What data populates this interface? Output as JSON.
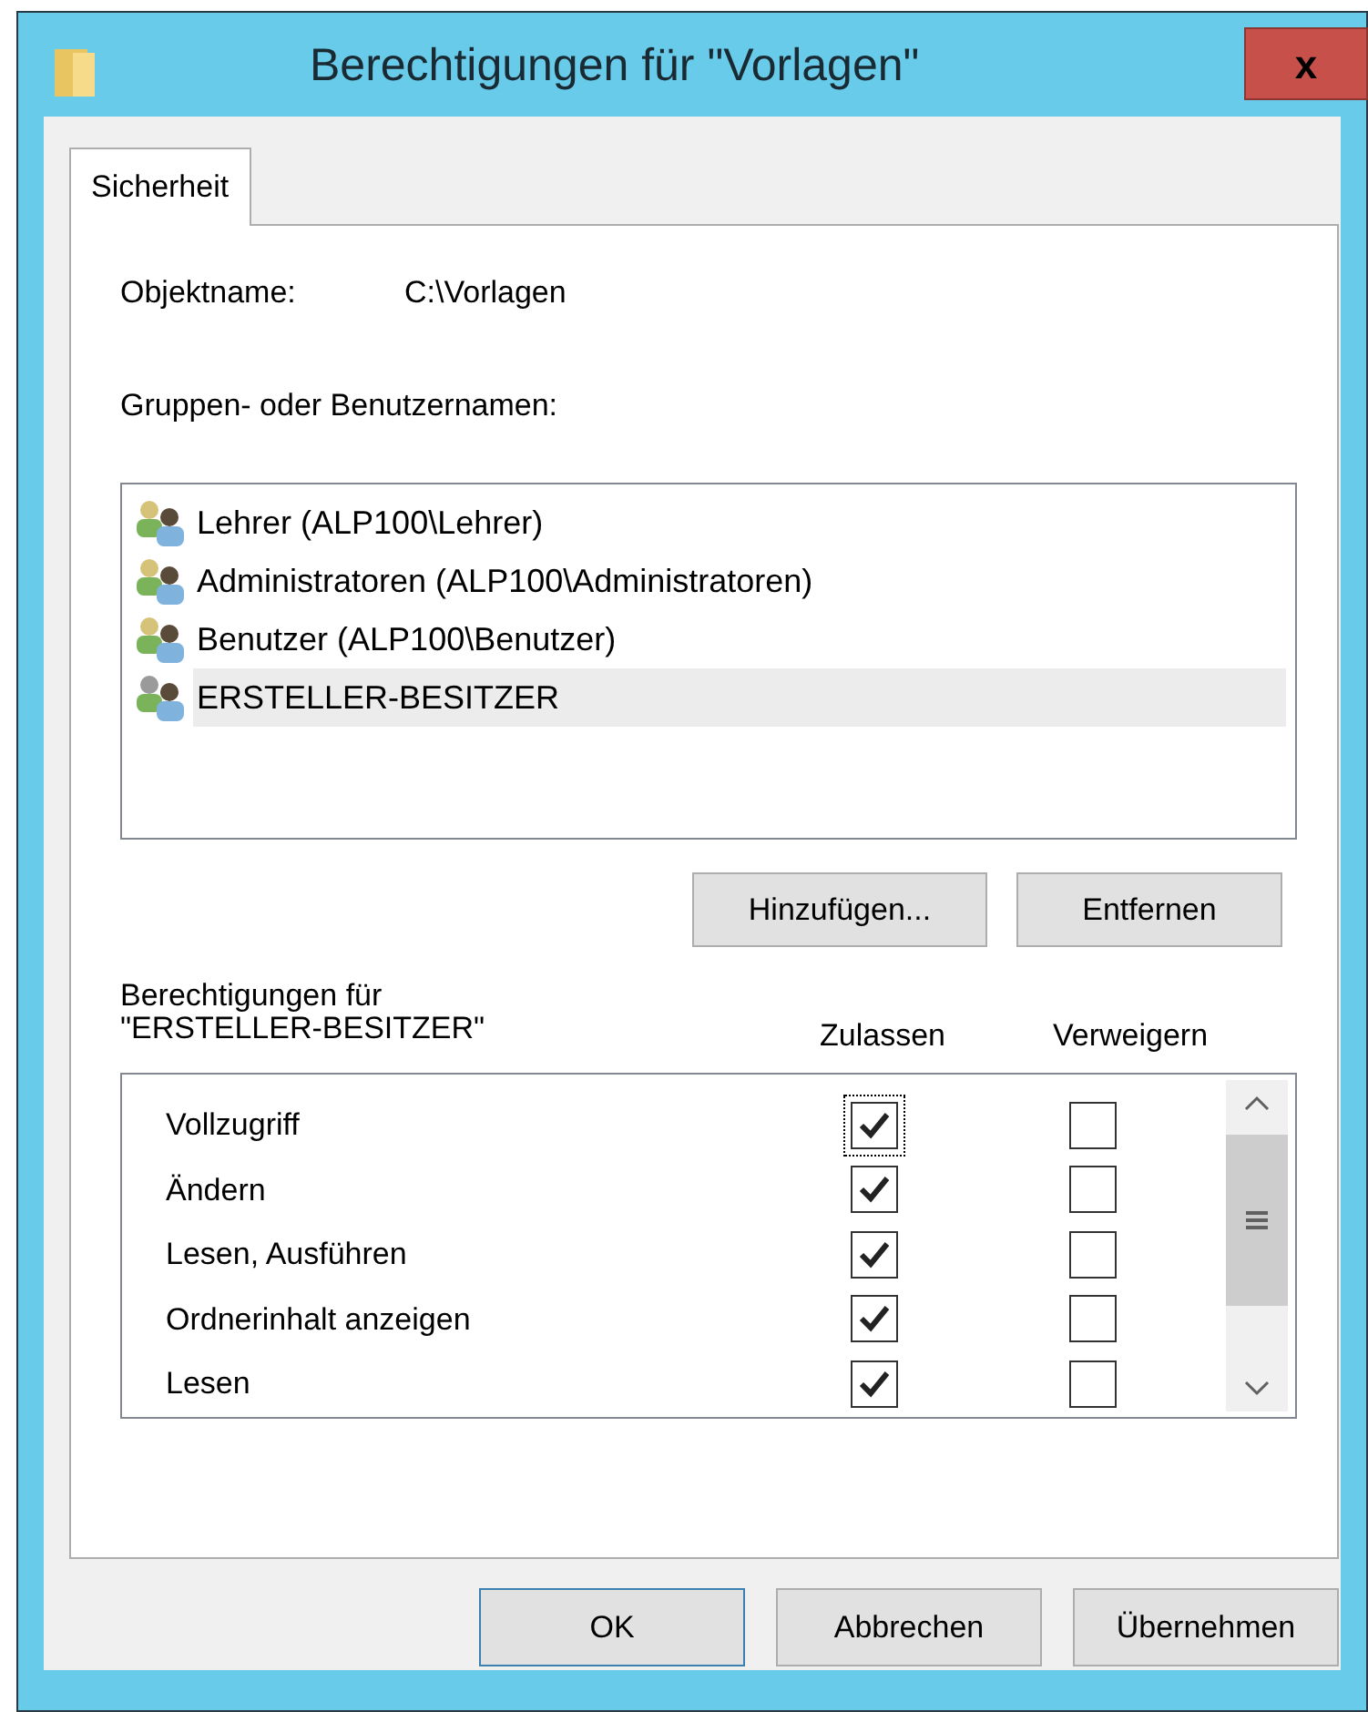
{
  "window": {
    "title": "Berechtigungen für \"Vorlagen\"",
    "close": "x"
  },
  "tabs": [
    {
      "label": "Sicherheit",
      "selected": true
    }
  ],
  "object": {
    "label": "Objektname:",
    "value": "C:\\Vorlagen"
  },
  "groups": {
    "label": "Gruppen- oder Benutzernamen:",
    "items": [
      {
        "name": "Lehrer (ALP100\\Lehrer)",
        "selected": false
      },
      {
        "name": "Administratoren (ALP100\\Administratoren)",
        "selected": false
      },
      {
        "name": "Benutzer (ALP100\\Benutzer)",
        "selected": false
      },
      {
        "name": "ERSTELLER-BESITZER",
        "selected": true
      }
    ]
  },
  "group_buttons": [
    "Hinzufügen...",
    "Entfernen"
  ],
  "permissions": {
    "label_line_1": "Berechtigungen für",
    "label_line_2": "\"ERSTELLER-BESITZER\"",
    "allow_header": "Zulassen",
    "deny_header": "Verweigern",
    "rows": [
      {
        "name": "Vollzugriff",
        "allow": true,
        "deny": false,
        "focused": true
      },
      {
        "name": "Ändern",
        "allow": true,
        "deny": false,
        "focused": false
      },
      {
        "name": "Lesen, Ausführen",
        "allow": true,
        "deny": false,
        "focused": false
      },
      {
        "name": "Ordnerinhalt anzeigen",
        "allow": true,
        "deny": false,
        "focused": false
      },
      {
        "name": "Lesen",
        "allow": true,
        "deny": false,
        "focused": false
      }
    ]
  },
  "buttons": [
    {
      "label": "OK",
      "default": true
    },
    {
      "label": "Abbrechen",
      "default": false
    },
    {
      "label": "Übernehmen",
      "default": false
    }
  ]
}
